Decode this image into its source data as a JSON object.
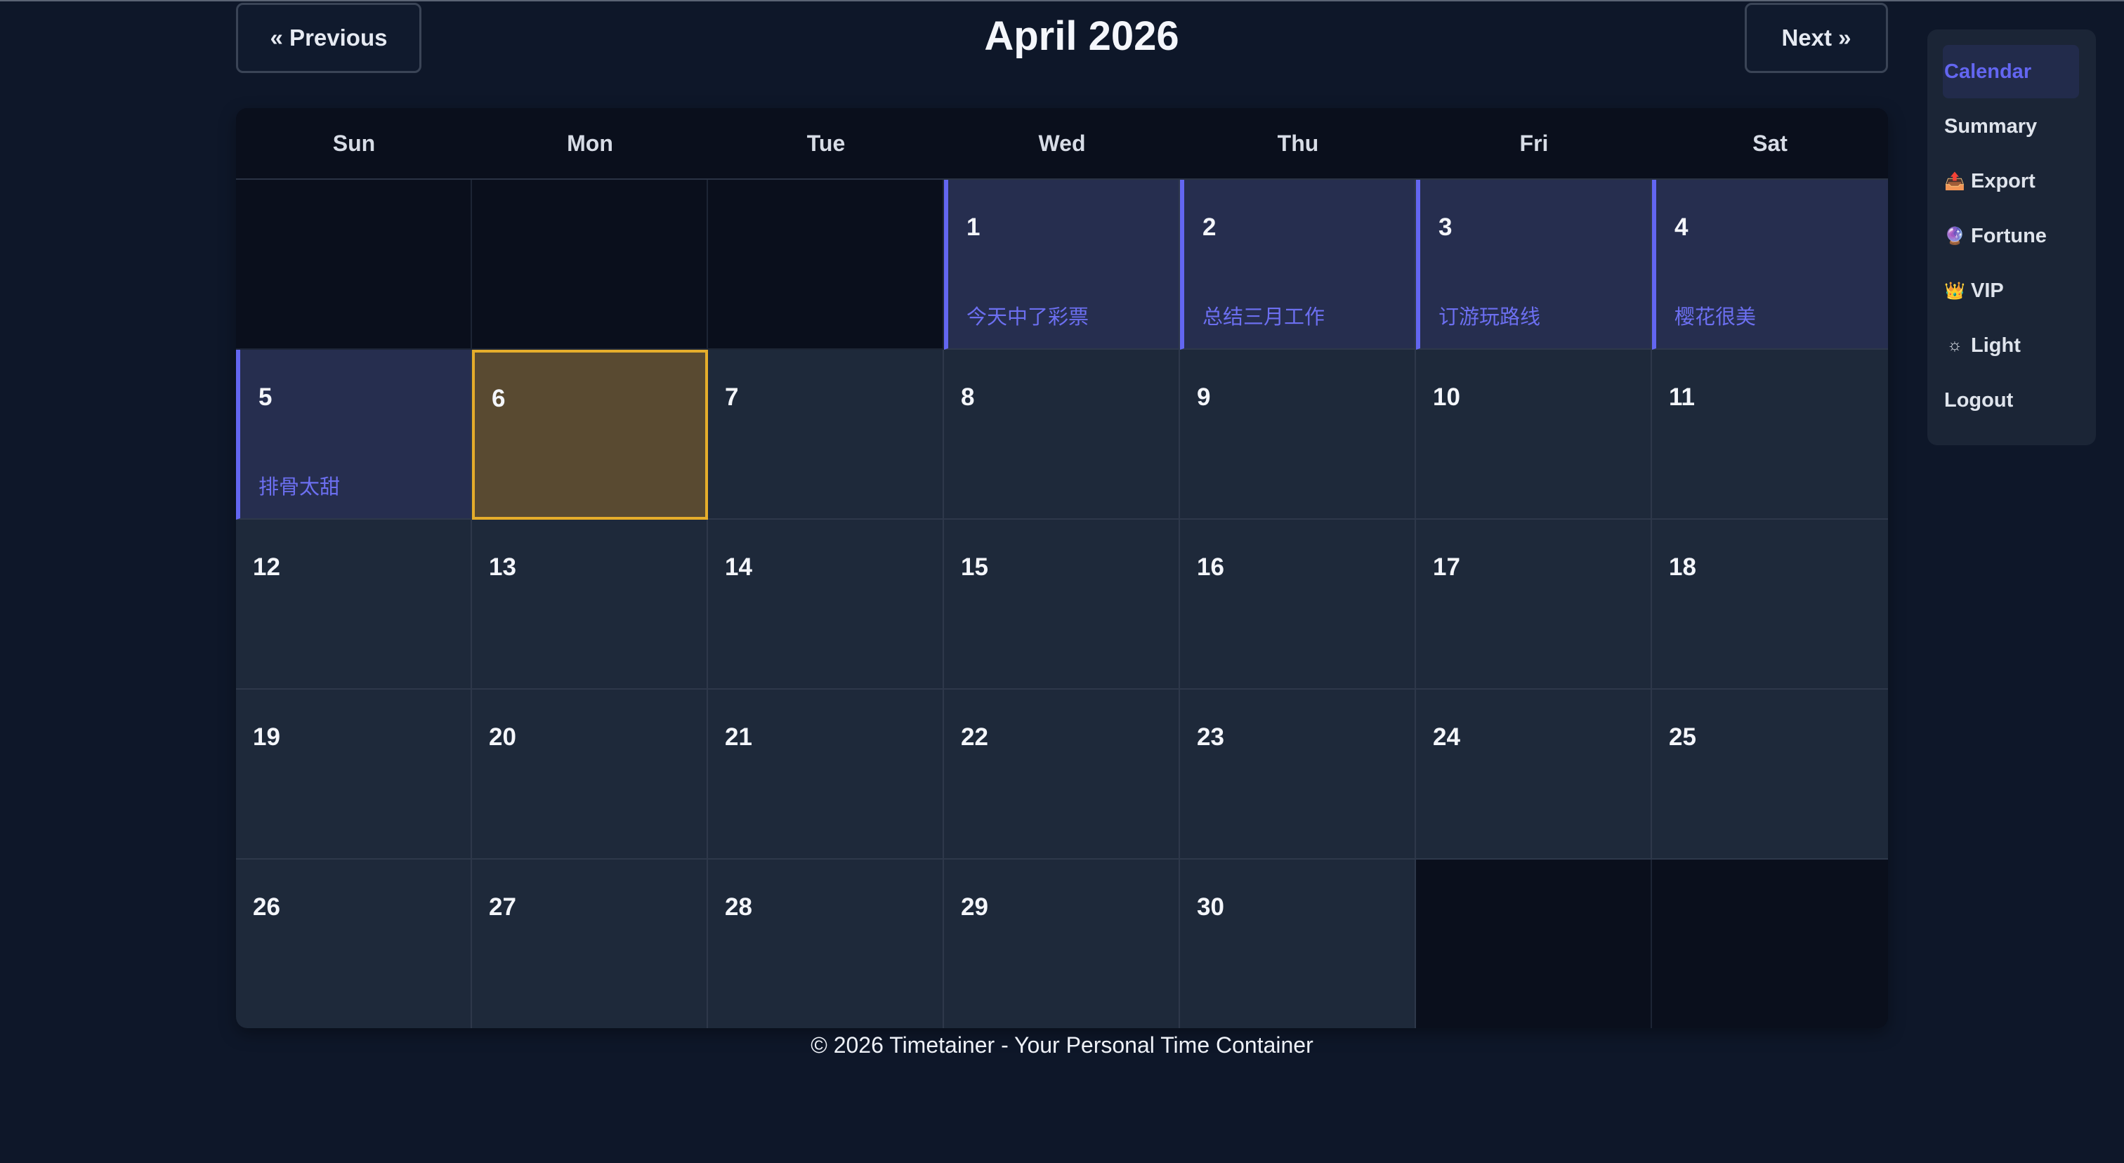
{
  "header": {
    "prev_label": "« Previous",
    "next_label": "Next »",
    "month_title": "April 2026"
  },
  "weekdays": [
    "Sun",
    "Mon",
    "Tue",
    "Wed",
    "Thu",
    "Fri",
    "Sat"
  ],
  "calendar": {
    "today": "6",
    "cells": [
      {
        "day": "",
        "entry": ""
      },
      {
        "day": "",
        "entry": ""
      },
      {
        "day": "",
        "entry": ""
      },
      {
        "day": "1",
        "entry": "今天中了彩票"
      },
      {
        "day": "2",
        "entry": "总结三月工作"
      },
      {
        "day": "3",
        "entry": "订游玩路线"
      },
      {
        "day": "4",
        "entry": "樱花很美"
      },
      {
        "day": "5",
        "entry": "排骨太甜"
      },
      {
        "day": "6",
        "entry": ""
      },
      {
        "day": "7",
        "entry": ""
      },
      {
        "day": "8",
        "entry": ""
      },
      {
        "day": "9",
        "entry": ""
      },
      {
        "day": "10",
        "entry": ""
      },
      {
        "day": "11",
        "entry": ""
      },
      {
        "day": "12",
        "entry": ""
      },
      {
        "day": "13",
        "entry": ""
      },
      {
        "day": "14",
        "entry": ""
      },
      {
        "day": "15",
        "entry": ""
      },
      {
        "day": "16",
        "entry": ""
      },
      {
        "day": "17",
        "entry": ""
      },
      {
        "day": "18",
        "entry": ""
      },
      {
        "day": "19",
        "entry": ""
      },
      {
        "day": "20",
        "entry": ""
      },
      {
        "day": "21",
        "entry": ""
      },
      {
        "day": "22",
        "entry": ""
      },
      {
        "day": "23",
        "entry": ""
      },
      {
        "day": "24",
        "entry": ""
      },
      {
        "day": "25",
        "entry": ""
      },
      {
        "day": "26",
        "entry": ""
      },
      {
        "day": "27",
        "entry": ""
      },
      {
        "day": "28",
        "entry": ""
      },
      {
        "day": "29",
        "entry": ""
      },
      {
        "day": "30",
        "entry": ""
      },
      {
        "day": "",
        "entry": ""
      },
      {
        "day": "",
        "entry": ""
      }
    ]
  },
  "footer": {
    "text": "© 2026 Timetainer - Your Personal Time Container"
  },
  "menu": {
    "active": "Calendar",
    "items": [
      {
        "label": "Calendar",
        "icon": "",
        "icon_name": ""
      },
      {
        "label": "Summary",
        "icon": "",
        "icon_name": ""
      },
      {
        "label": "Export",
        "icon": "📤",
        "icon_name": "outbox-tray-icon"
      },
      {
        "label": "Fortune",
        "icon": "🔮",
        "icon_name": "crystal-ball-icon"
      },
      {
        "label": "VIP",
        "icon": "👑",
        "icon_name": "crown-icon"
      },
      {
        "label": "Light",
        "icon": "☼",
        "icon_name": "sun-icon"
      },
      {
        "label": "Logout",
        "icon": "",
        "icon_name": ""
      }
    ]
  },
  "colors": {
    "background": "#0e1729",
    "cell": "#1e293a",
    "empty_cell": "#0a0f1c",
    "entry_cell": "#262e4f",
    "accent": "#6366f1",
    "today_bg": "#594a31",
    "today_border": "#e5ad2b"
  }
}
